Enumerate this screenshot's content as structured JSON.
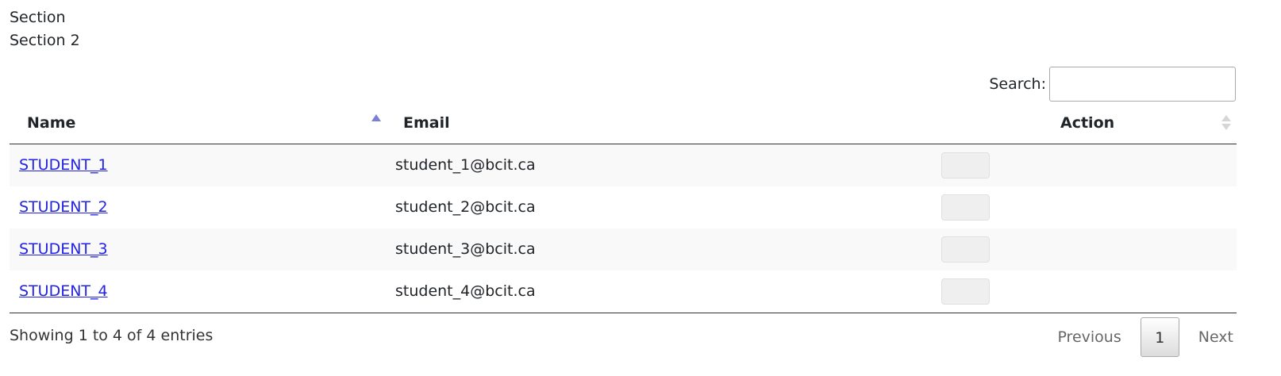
{
  "header": {
    "line1": "Section",
    "line2": "Section 2"
  },
  "search": {
    "label": "Search:",
    "value": "",
    "placeholder": ""
  },
  "table": {
    "columns": [
      "Name",
      "Email",
      "Action"
    ],
    "sort": {
      "Name": "ascending",
      "Action": "unsorted"
    },
    "rows": [
      {
        "name": "STUDENT_1",
        "email": "student_1@bcit.ca",
        "action_label": ""
      },
      {
        "name": "STUDENT_2",
        "email": "student_2@bcit.ca",
        "action_label": ""
      },
      {
        "name": "STUDENT_3",
        "email": "student_3@bcit.ca",
        "action_label": ""
      },
      {
        "name": "STUDENT_4",
        "email": "student_4@bcit.ca",
        "action_label": ""
      }
    ]
  },
  "footer": {
    "info": "Showing 1 to 4 of 4 entries"
  },
  "pagination": {
    "previous": "Previous",
    "current": "1",
    "next": "Next"
  },
  "colors": {
    "link": "#2323e6",
    "sort_active": "#7c7fd6",
    "row_stripe": "#f9f9f9"
  }
}
